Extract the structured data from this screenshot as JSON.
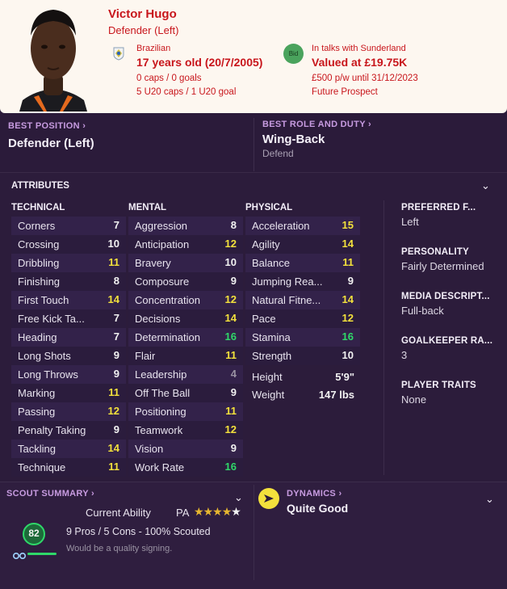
{
  "player": {
    "name": "Victor Hugo",
    "position": "Defender (Left)",
    "nationality": "Brazilian",
    "age": "17 years old (20/7/2005)",
    "caps": "0 caps / 0 goals",
    "u20_caps": "5 U20 caps / 1 U20 goal",
    "bid_badge": "Bid",
    "transfer_status": "In talks with Sunderland",
    "value": "Valued at £19.75K",
    "contract": "£500 p/w until 31/12/2023",
    "status": "Future Prospect"
  },
  "best_position": {
    "label": "BEST POSITION",
    "value": "Defender (Left)"
  },
  "best_role": {
    "label": "BEST ROLE AND DUTY",
    "role": "Wing-Back",
    "duty": "Defend"
  },
  "attributes": {
    "title": "ATTRIBUTES",
    "technical": {
      "title": "TECHNICAL",
      "rows": [
        {
          "name": "Corners",
          "value": "7",
          "tone": "w"
        },
        {
          "name": "Crossing",
          "value": "10",
          "tone": "w"
        },
        {
          "name": "Dribbling",
          "value": "11",
          "tone": "y"
        },
        {
          "name": "Finishing",
          "value": "8",
          "tone": "w"
        },
        {
          "name": "First Touch",
          "value": "14",
          "tone": "y"
        },
        {
          "name": "Free Kick Ta...",
          "value": "7",
          "tone": "w"
        },
        {
          "name": "Heading",
          "value": "7",
          "tone": "w"
        },
        {
          "name": "Long Shots",
          "value": "9",
          "tone": "w"
        },
        {
          "name": "Long Throws",
          "value": "9",
          "tone": "w"
        },
        {
          "name": "Marking",
          "value": "11",
          "tone": "y"
        },
        {
          "name": "Passing",
          "value": "12",
          "tone": "y"
        },
        {
          "name": "Penalty Taking",
          "value": "9",
          "tone": "w"
        },
        {
          "name": "Tackling",
          "value": "14",
          "tone": "y"
        },
        {
          "name": "Technique",
          "value": "11",
          "tone": "y"
        }
      ]
    },
    "mental": {
      "title": "MENTAL",
      "rows": [
        {
          "name": "Aggression",
          "value": "8",
          "tone": "w"
        },
        {
          "name": "Anticipation",
          "value": "12",
          "tone": "y"
        },
        {
          "name": "Bravery",
          "value": "10",
          "tone": "w"
        },
        {
          "name": "Composure",
          "value": "9",
          "tone": "w"
        },
        {
          "name": "Concentration",
          "value": "12",
          "tone": "y"
        },
        {
          "name": "Decisions",
          "value": "14",
          "tone": "y"
        },
        {
          "name": "Determination",
          "value": "16",
          "tone": "g"
        },
        {
          "name": "Flair",
          "value": "11",
          "tone": "y"
        },
        {
          "name": "Leadership",
          "value": "4",
          "tone": "gr"
        },
        {
          "name": "Off The Ball",
          "value": "9",
          "tone": "w"
        },
        {
          "name": "Positioning",
          "value": "11",
          "tone": "y"
        },
        {
          "name": "Teamwork",
          "value": "12",
          "tone": "y"
        },
        {
          "name": "Vision",
          "value": "9",
          "tone": "w"
        },
        {
          "name": "Work Rate",
          "value": "16",
          "tone": "g"
        }
      ]
    },
    "physical": {
      "title": "PHYSICAL",
      "rows": [
        {
          "name": "Acceleration",
          "value": "15",
          "tone": "y"
        },
        {
          "name": "Agility",
          "value": "14",
          "tone": "y"
        },
        {
          "name": "Balance",
          "value": "11",
          "tone": "y"
        },
        {
          "name": "Jumping Rea...",
          "value": "9",
          "tone": "w"
        },
        {
          "name": "Natural Fitne...",
          "value": "14",
          "tone": "y"
        },
        {
          "name": "Pace",
          "value": "12",
          "tone": "y"
        },
        {
          "name": "Stamina",
          "value": "16",
          "tone": "g"
        },
        {
          "name": "Strength",
          "value": "10",
          "tone": "w"
        }
      ],
      "height_label": "Height",
      "height": "5'9\"",
      "weight_label": "Weight",
      "weight": "147 lbs"
    }
  },
  "side_info": [
    {
      "label": "PREFERRED F...",
      "value": "Left"
    },
    {
      "label": "PERSONALITY",
      "value": "Fairly Determined"
    },
    {
      "label": "MEDIA DESCRIPT...",
      "value": "Full-back"
    },
    {
      "label": "GOALKEEPER RA...",
      "value": "3"
    },
    {
      "label": "PLAYER TRAITS",
      "value": "None"
    }
  ],
  "scout": {
    "title": "SCOUT SUMMARY",
    "ca_label": "Current Ability",
    "pa_label": "PA",
    "pa_stars": 4.5,
    "score": "82",
    "summary": "9 Pros / 5 Cons - 100% Scouted",
    "verdict": "Would be a quality signing."
  },
  "dynamics": {
    "title": "DYNAMICS",
    "value": "Quite Good"
  },
  "colors": {
    "yellow": "#f3e13c",
    "green": "#2fd869",
    "accent_purple": "#c79be0",
    "red": "#c8161c"
  }
}
